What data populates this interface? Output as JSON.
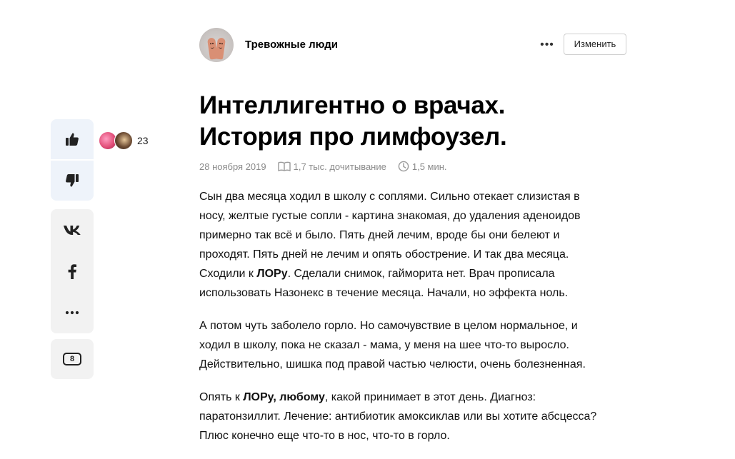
{
  "channel": {
    "name": "Тревожные люди",
    "more_label": "•••",
    "edit_label": "Изменить"
  },
  "article": {
    "title_lines": [
      "Интеллигентно о врачах.",
      "История про лимфоузел."
    ],
    "meta": {
      "date": "28 ноября 2019",
      "reads": "1,7 тыс. дочитывание",
      "read_time": "1,5 мин."
    },
    "paragraphs": [
      {
        "lines": [
          [
            "Сын два месяца ходил в школу с соплями. Сильно отекает слизистая в"
          ],
          [
            "носу, желтые густые сопли - картина знакомая, до удаления аденоидов"
          ],
          [
            "примерно так всё и было. Пять дней лечим, вроде бы они белеют и"
          ],
          [
            "проходят. Пять дней не лечим и опять обострение. И так два месяца."
          ],
          [
            "Сходили к ",
            "ЛОРу",
            ". Сделали снимок, гайморита нет. Врач прописала"
          ],
          [
            "использовать Назонекс в течение месяца. Начали, но эффекта ноль."
          ]
        ]
      },
      {
        "lines": [
          [
            "А потом чуть заболело горло. Но самочувствие в целом нормальное, и"
          ],
          [
            "ходил в школу, пока не сказал - мама, у меня на шее что-то выросло."
          ],
          [
            "Действительно, шишка под правой частью челюсти, очень болезненная."
          ]
        ]
      },
      {
        "lines": [
          [
            "Опять к ",
            "ЛОРу, любому",
            ", какой принимает в этот день. Диагноз:"
          ],
          [
            "паратонзиллит. Лечение: антибиотик амоксиклав или вы хотите абсцесса?"
          ],
          [
            "Плюс конечно еще что-то в нос, что-то в горло."
          ]
        ]
      }
    ]
  },
  "rail": {
    "likes_count": "23",
    "comments_count": "8"
  },
  "icons": {
    "like": "thumbs-up-icon",
    "dislike": "thumbs-down-icon",
    "vk": "vk-icon",
    "facebook": "facebook-icon",
    "more": "more-dots-icon",
    "comments": "comment-icon",
    "reads": "book-icon",
    "time": "clock-icon"
  },
  "colors": {
    "reactions_bg": "#eef3fa",
    "share_bg": "#f2f2f2",
    "meta_text": "#8a8a8a"
  }
}
